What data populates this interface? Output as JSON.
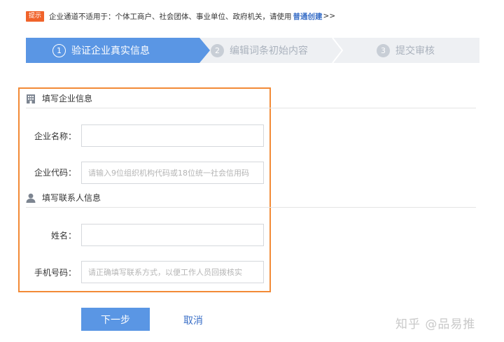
{
  "tip": {
    "badge": "提示",
    "text": "企业通道不适用于：个体工商户、社会团体、事业单位、政府机关，请使用",
    "link": "普通创建",
    "suffix": ">>"
  },
  "steps": [
    {
      "num": "1",
      "label": "验证企业真实信息",
      "state": "active"
    },
    {
      "num": "2",
      "label": "编辑词条初始内容",
      "state": "inactive"
    },
    {
      "num": "3",
      "label": "提交审核",
      "state": "inactive"
    }
  ],
  "company_section": {
    "title": "填写企业信息",
    "icon": "building-icon",
    "name_label": "企业名称：",
    "name_value": "",
    "name_placeholder": "",
    "code_label": "企业代码：",
    "code_value": "",
    "code_placeholder": "请输入9位组织机构代码或18位统一社会信用码"
  },
  "contact_section": {
    "title": "填写联系人信息",
    "icon": "person-icon",
    "name_label": "姓名：",
    "name_value": "",
    "name_placeholder": "",
    "phone_label": "手机号码：",
    "phone_value": "",
    "phone_placeholder": "请正确填写联系方式，以便工作人员回拨核实"
  },
  "actions": {
    "next_label": "下一步",
    "cancel_label": "取消"
  },
  "watermark": "知乎 @品易推",
  "colors": {
    "accent": "#5a96e4",
    "highlight_border": "#f28a36",
    "tip_badge": "#f0632b",
    "link": "#3a6fc7"
  }
}
